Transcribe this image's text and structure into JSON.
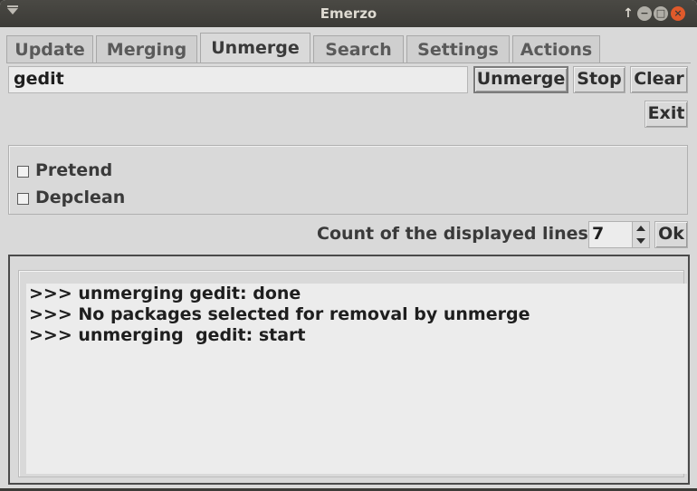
{
  "window": {
    "title": "Emerzo"
  },
  "tabs": [
    {
      "label": "Update"
    },
    {
      "label": "Merging"
    },
    {
      "label": "Unmerge"
    },
    {
      "label": "Search"
    },
    {
      "label": "Settings"
    },
    {
      "label": "Actions"
    }
  ],
  "active_tab": "Unmerge",
  "unmerge": {
    "package_value": "gedit",
    "unmerge_label": "Unmerge",
    "stop_label": "Stop",
    "clear_label": "Clear",
    "exit_label": "Exit"
  },
  "options": {
    "pretend_label": "Pretend",
    "pretend_checked": false,
    "depclean_label": "Depclean",
    "depclean_checked": false
  },
  "count": {
    "label": "Count of the displayed lines",
    "value": "7",
    "ok_label": "Ok"
  },
  "log": {
    "lines": [
      ">>> unmerging gedit: done",
      ">>> No packages selected for removal by unmerge",
      ">>> unmerging  gedit: start"
    ]
  },
  "colors": {
    "window_bg": "#d9d9d9",
    "titlebar_bg": "#3c3b37",
    "close_button": "#e05a2b"
  }
}
